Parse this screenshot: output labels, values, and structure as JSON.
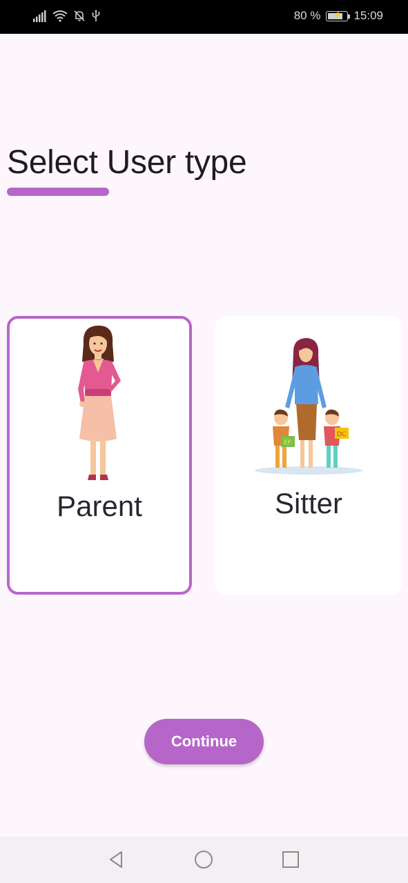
{
  "status_bar": {
    "battery_percent": "80 %",
    "battery_level": 0.8,
    "time": "15:09",
    "icons": [
      "signal-icon",
      "wifi-icon",
      "bell-off-icon",
      "usb-icon",
      "battery-icon"
    ]
  },
  "title": "Select User type",
  "accent_color": "#b666c8",
  "cards": [
    {
      "label": "Parent",
      "selected": true,
      "illustration": "parent-woman-illustration"
    },
    {
      "label": "Sitter",
      "selected": false,
      "illustration": "sitter-with-children-illustration"
    }
  ],
  "continue_label": "Continue",
  "nav": {
    "icons": [
      "back-icon",
      "home-icon",
      "recent-apps-icon"
    ]
  }
}
